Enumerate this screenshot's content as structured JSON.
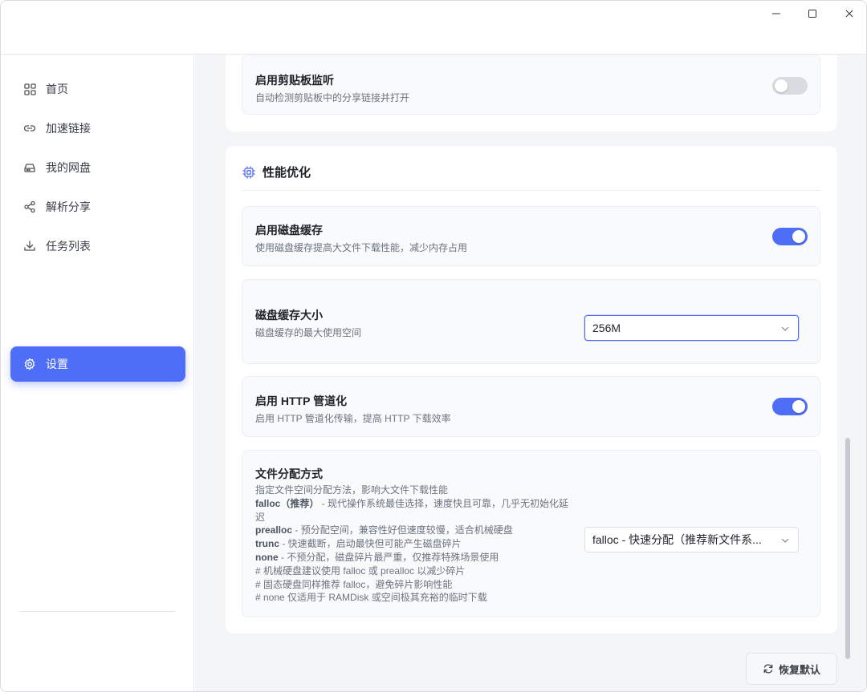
{
  "sidebar": {
    "items": [
      {
        "label": "首页",
        "icon": "grid-icon"
      },
      {
        "label": "加速链接",
        "icon": "link-icon"
      },
      {
        "label": "我的网盘",
        "icon": "drive-icon"
      },
      {
        "label": "解析分享",
        "icon": "share-icon"
      },
      {
        "label": "任务列表",
        "icon": "download-icon"
      }
    ],
    "settings": {
      "label": "设置",
      "icon": "gear-icon"
    }
  },
  "clipboard": {
    "label": "启用剪贴板监听",
    "desc": "自动检测剪贴板中的分享链接并打开",
    "enabled": false
  },
  "performance": {
    "title": "性能优化",
    "disk_cache": {
      "label": "启用磁盘缓存",
      "desc": "使用磁盘缓存提高大文件下载性能，减少内存占用",
      "enabled": true
    },
    "cache_size": {
      "label": "磁盘缓存大小",
      "desc": "磁盘缓存的最大使用空间",
      "value": "256M"
    },
    "http_pipelining": {
      "label": "启用 HTTP 管道化",
      "desc": "启用 HTTP 管道化传输，提高 HTTP 下载效率",
      "enabled": true
    },
    "file_alloc": {
      "label": "文件分配方式",
      "desc": "指定文件空间分配方法，影响大文件下载性能",
      "falloc_name": "falloc（推荐）",
      "falloc_desc": " - 现代操作系统最佳选择，速度快且可靠，几乎无初始化延迟",
      "prealloc_name": "prealloc",
      "prealloc_desc": " - 预分配空间，兼容性好但速度较慢，适合机械硬盘",
      "trunc_name": "trunc",
      "trunc_desc": " - 快速截断，启动最快但可能产生磁盘碎片",
      "none_name": "none",
      "none_desc": " - 不预分配，磁盘碎片最严重，仅推荐特殊场景使用",
      "note1": "# 机械硬盘建议使用 falloc 或 prealloc 以减少碎片",
      "note2": "# 固态硬盘同样推荐 falloc，避免碎片影响性能",
      "note3": "# none 仅适用于 RAMDisk 或空间极其充裕的临时下载",
      "value": "falloc - 快速分配（推荐新文件系..."
    }
  },
  "reset_label": "恢复默认",
  "colors": {
    "accent": "#4f6ef7"
  }
}
